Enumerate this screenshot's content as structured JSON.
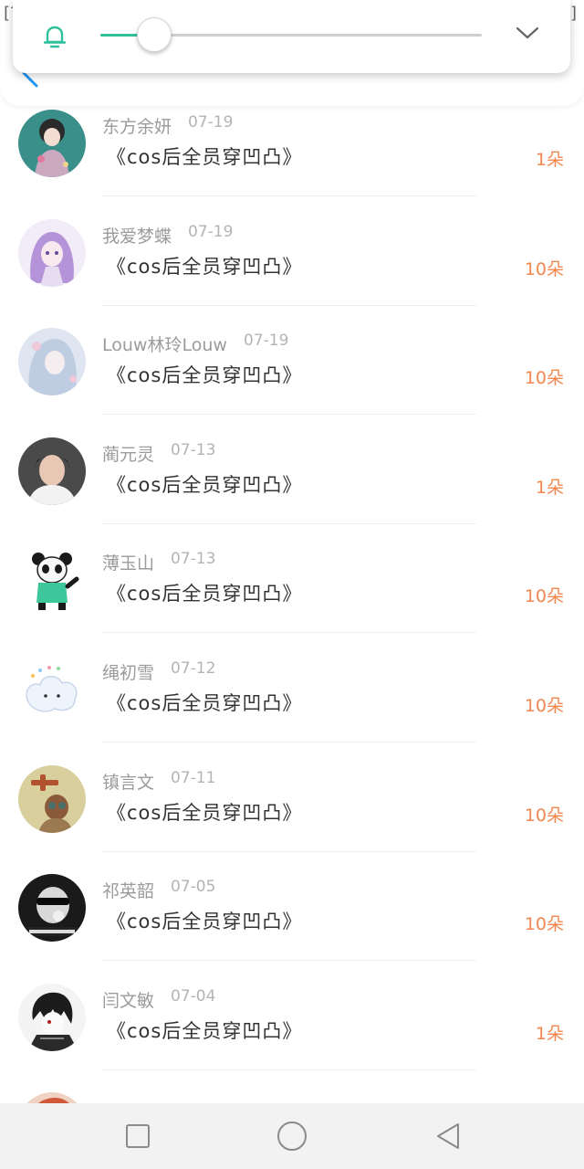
{
  "status_bar": {
    "left": "[?]",
    "time": "[?]",
    "right": "[?]"
  },
  "volume": {
    "level": 0.14,
    "accent": "#2fbf9a",
    "icon": "bell-icon",
    "collapse_icon": "chevron-down-icon"
  },
  "header": {
    "back_icon": "back-arrow-icon"
  },
  "list": [
    {
      "name": "东方余妍",
      "date": "07-19",
      "title": "《cos后全员穿凹凸》",
      "count": "1朵",
      "avatar_color": "#4a9e9a"
    },
    {
      "name": "我爱梦蝶",
      "date": "07-19",
      "title": "《cos后全员穿凹凸》",
      "count": "10朵",
      "avatar_color": "#b89ad8"
    },
    {
      "name": "Louw林玲Louw",
      "date": "07-19",
      "title": "《cos后全员穿凹凸》",
      "count": "10朵",
      "avatar_color": "#c7d2e8"
    },
    {
      "name": "蔺元灵",
      "date": "07-13",
      "title": "《cos后全员穿凹凸》",
      "count": "1朵",
      "avatar_color": "#3a3a3a"
    },
    {
      "name": "薄玉山",
      "date": "07-13",
      "title": "《cos后全员穿凹凸》",
      "count": "10朵",
      "avatar_color": "#ffffff"
    },
    {
      "name": "绳初雪",
      "date": "07-12",
      "title": "《cos后全员穿凹凸》",
      "count": "10朵",
      "avatar_color": "#e8f0f8"
    },
    {
      "name": "镇言文",
      "date": "07-11",
      "title": "《cos后全员穿凹凸》",
      "count": "10朵",
      "avatar_color": "#c9b57a"
    },
    {
      "name": "祁英韶",
      "date": "07-05",
      "title": "《cos后全员穿凹凸》",
      "count": "10朵",
      "avatar_color": "#1e1e1e"
    },
    {
      "name": "闫文敏",
      "date": "07-04",
      "title": "《cos后全员穿凹凸》",
      "count": "1朵",
      "avatar_color": "#d8d8d8"
    }
  ],
  "count_color": "#f2874f",
  "nav": {
    "recent_icon": "square-icon",
    "home_icon": "circle-icon",
    "back_icon": "triangle-back-icon"
  }
}
